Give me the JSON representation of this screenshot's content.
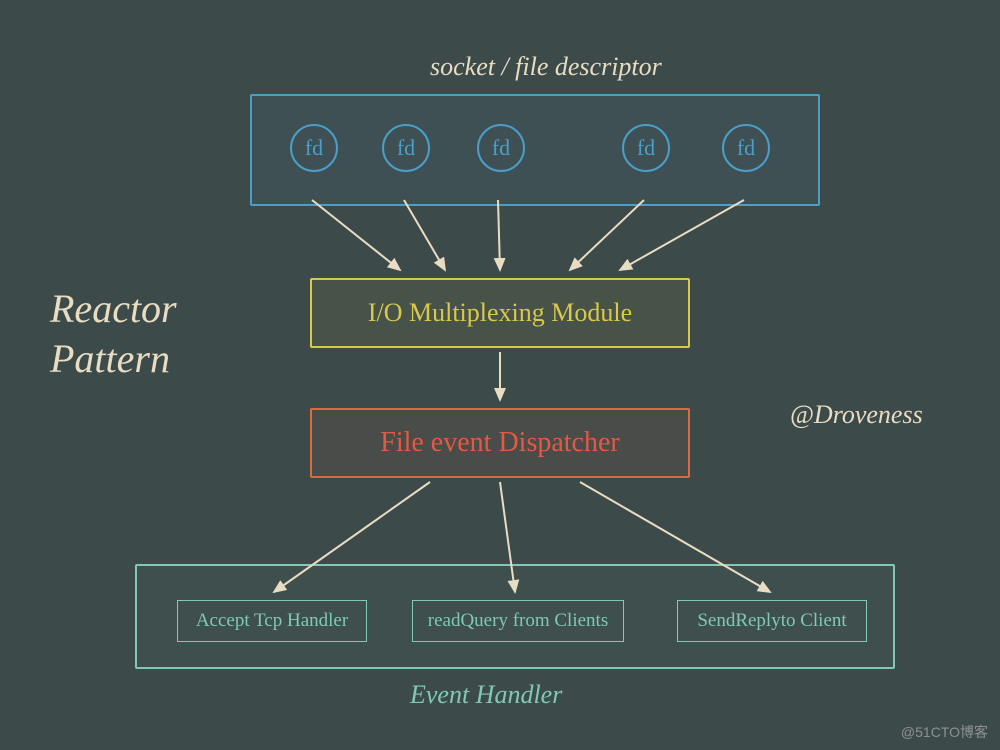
{
  "title": {
    "line1": "Reactor",
    "line2": "Pattern"
  },
  "socket_label": "socket / file descriptor",
  "fds": [
    "fd",
    "fd",
    "fd",
    "fd",
    "fd"
  ],
  "mux_label": "I/O Multiplexing Module",
  "dispatcher_label": "File event Dispatcher",
  "author": "@Droveness",
  "event_handler_label": "Event Handler",
  "handlers": [
    "Accept Tcp Handler",
    "readQuery from Clients",
    "SendReplyto Client"
  ],
  "watermark": "@51CTO博客",
  "colors": {
    "bg": "#3d4a4a",
    "cream": "#e8dcc3",
    "blue": "#4a9fc9",
    "yellow": "#d8c94a",
    "orange": "#d96b3e",
    "red": "#e35a42",
    "teal": "#7fc9b5"
  }
}
